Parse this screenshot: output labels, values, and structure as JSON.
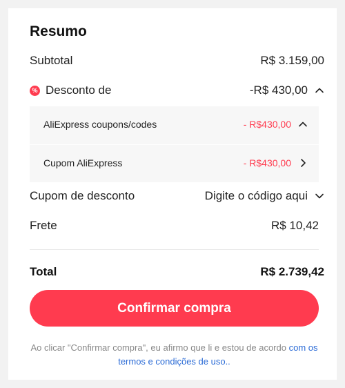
{
  "summary": {
    "title": "Resumo",
    "subtotal_label": "Subtotal",
    "subtotal_value": "R$ 3.159,00",
    "discount_icon_glyph": "%",
    "discount_label": "Desconto de",
    "discount_value": "-R$ 430,00",
    "discount_chevron_icon": "chevron-up-icon",
    "discount_items": [
      {
        "label": "AliExpress coupons/codes",
        "value": "- R$430,00",
        "icon": "chevron-up-icon"
      },
      {
        "label": "Cupom AliExpress",
        "value": "- R$430,00",
        "icon": "chevron-right-icon"
      }
    ],
    "coupon_label": "Cupom de desconto",
    "coupon_value": "Digite o código aqui",
    "coupon_chevron_icon": "chevron-down-icon",
    "shipping_label": "Frete",
    "shipping_value": "R$ 10,42",
    "total_label": "Total",
    "total_value": "R$ 2.739,42"
  },
  "confirm_button_label": "Confirmar compra",
  "disclaimer": {
    "text": "Ao clicar \"Confirmar compra\", eu afirmo que li e estou de acordo",
    "link": "com os termos e condições de uso.."
  },
  "colors": {
    "accent": "#ff3b4f",
    "link": "#2b6bd6",
    "background": "#f2f2f2",
    "panel": "#f7f7f7"
  }
}
